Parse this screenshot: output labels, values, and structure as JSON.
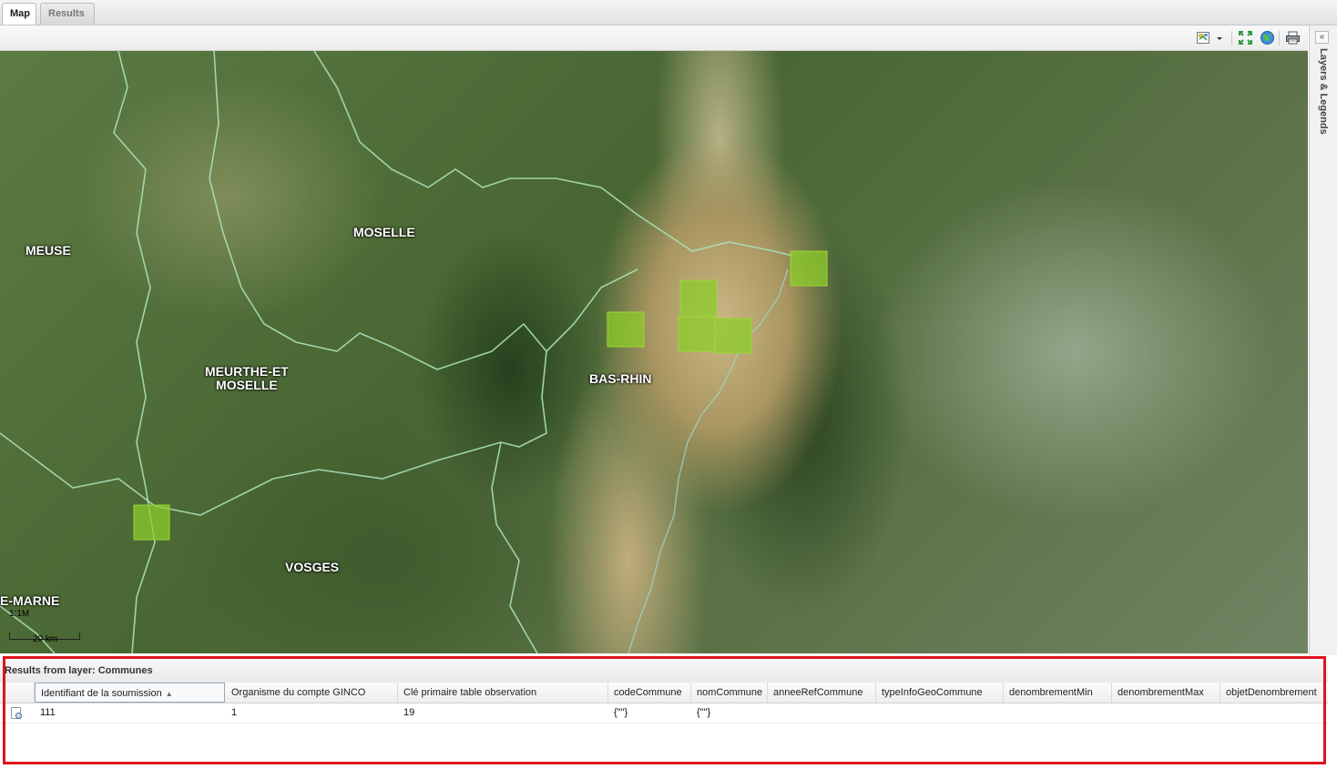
{
  "tabs": [
    {
      "label": "Map",
      "active": true
    },
    {
      "label": "Results",
      "active": false
    }
  ],
  "toolbar": {
    "icons": [
      "legend-icon",
      "dropdown-arrow-icon",
      "zoom-extent-icon",
      "globe-icon",
      "print-icon"
    ]
  },
  "side_panel": {
    "title": "Layers & Legends",
    "collapse_label": "«"
  },
  "map": {
    "labels": {
      "meuse": "MEUSE",
      "moselle": "MOSELLE",
      "meurthe": "MEURTHE-ET\nMOSELLE",
      "bas_rhin": "BAS-RHIN",
      "vosges": "VOSGES",
      "haute_marne": "E-MARNE"
    },
    "scale_ratio": "1:1M",
    "scale_label": "20 km",
    "colors": {
      "selection_fill": "#8ccc2a",
      "boundary": "#a8e0b8"
    }
  },
  "results": {
    "title": "Results from layer: Communes",
    "columns": [
      "Identifiant de la soumission",
      "Organisme du compte GINCO",
      "Clé primaire table observation",
      "codeCommune",
      "nomCommune",
      "anneeRefCommune",
      "typeInfoGeoCommune",
      "denombrementMin",
      "denombrementMax",
      "objetDenombrement"
    ],
    "sorted_column": "Identifiant de la soumission",
    "rows": [
      [
        "111",
        "1",
        "19",
        "{\"\"}",
        "{\"\"}",
        "",
        "",
        "",
        "",
        ""
      ]
    ]
  }
}
